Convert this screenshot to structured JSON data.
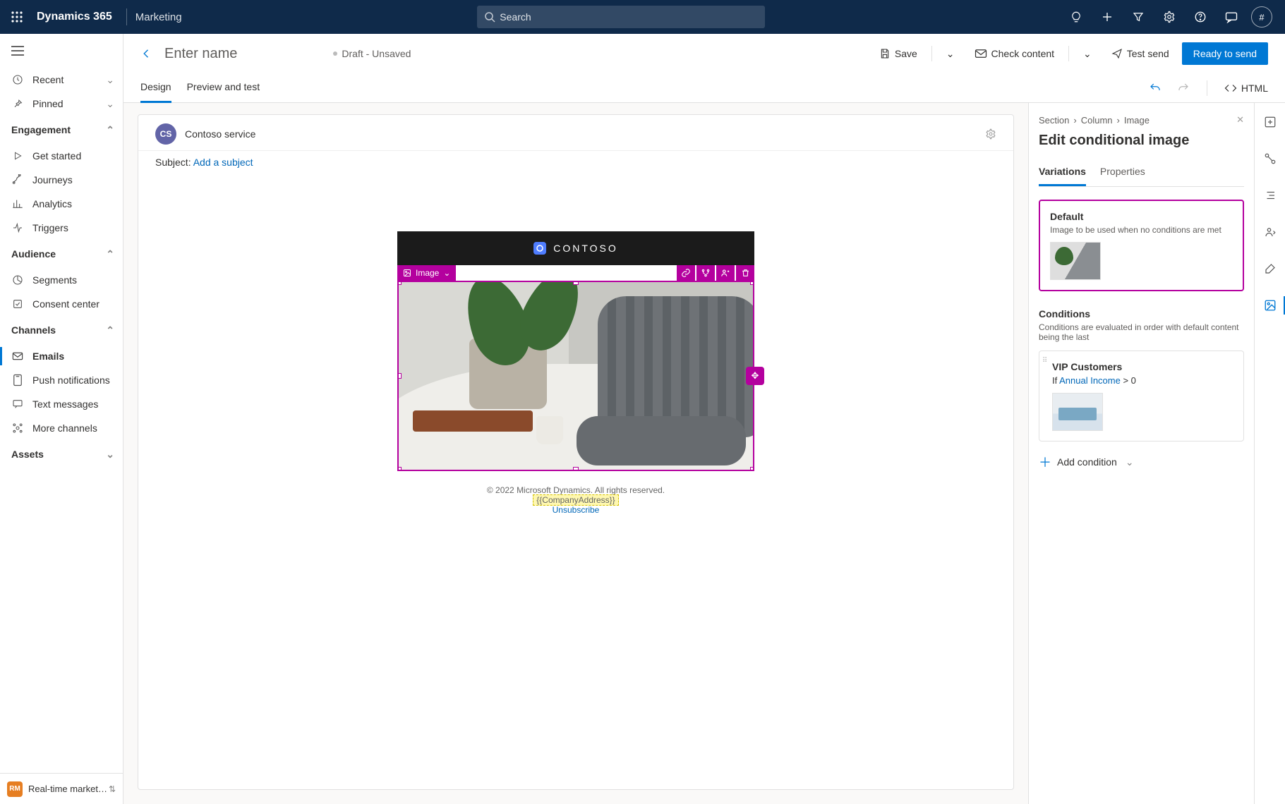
{
  "topbar": {
    "brand": "Dynamics 365",
    "sub": "Marketing",
    "search_placeholder": "Search",
    "avatar": "#"
  },
  "leftnav": {
    "recent": "Recent",
    "pinned": "Pinned",
    "engagement": "Engagement",
    "get_started": "Get started",
    "journeys": "Journeys",
    "analytics": "Analytics",
    "triggers": "Triggers",
    "audience": "Audience",
    "segments": "Segments",
    "consent": "Consent center",
    "channels": "Channels",
    "emails": "Emails",
    "push": "Push notifications",
    "texts": "Text messages",
    "more": "More channels",
    "assets": "Assets",
    "bottom_badge": "RM",
    "bottom_label": "Real-time marketi…"
  },
  "page": {
    "title": "Enter name",
    "status": "Draft - Unsaved",
    "save": "Save",
    "check": "Check content",
    "test": "Test send",
    "ready": "Ready to send",
    "tab_design": "Design",
    "tab_preview": "Preview and test",
    "html": "HTML"
  },
  "email": {
    "from_initials": "CS",
    "from": "Contoso service",
    "subject_label": "Subject: ",
    "subject_add": "Add a subject",
    "brand": "CONTOSO",
    "sel_label": "Image",
    "footer_copyright": "© 2022 Microsoft Dynamics. All rights reserved.",
    "footer_token": "{{CompanyAddress}}",
    "footer_unsub": "Unsubscribe"
  },
  "panel": {
    "bc_section": "Section",
    "bc_column": "Column",
    "bc_image": "Image",
    "title": "Edit conditional image",
    "tab_variations": "Variations",
    "tab_properties": "Properties",
    "default_title": "Default",
    "default_sub": "Image to be used when no conditions are met",
    "conditions_title": "Conditions",
    "conditions_sub": "Conditions are evaluated in order with default content being the last",
    "cond1_title": "VIP Customers",
    "cond1_if": "If ",
    "cond1_field": "Annual Income",
    "cond1_op": " > 0",
    "add_condition": "Add condition"
  }
}
